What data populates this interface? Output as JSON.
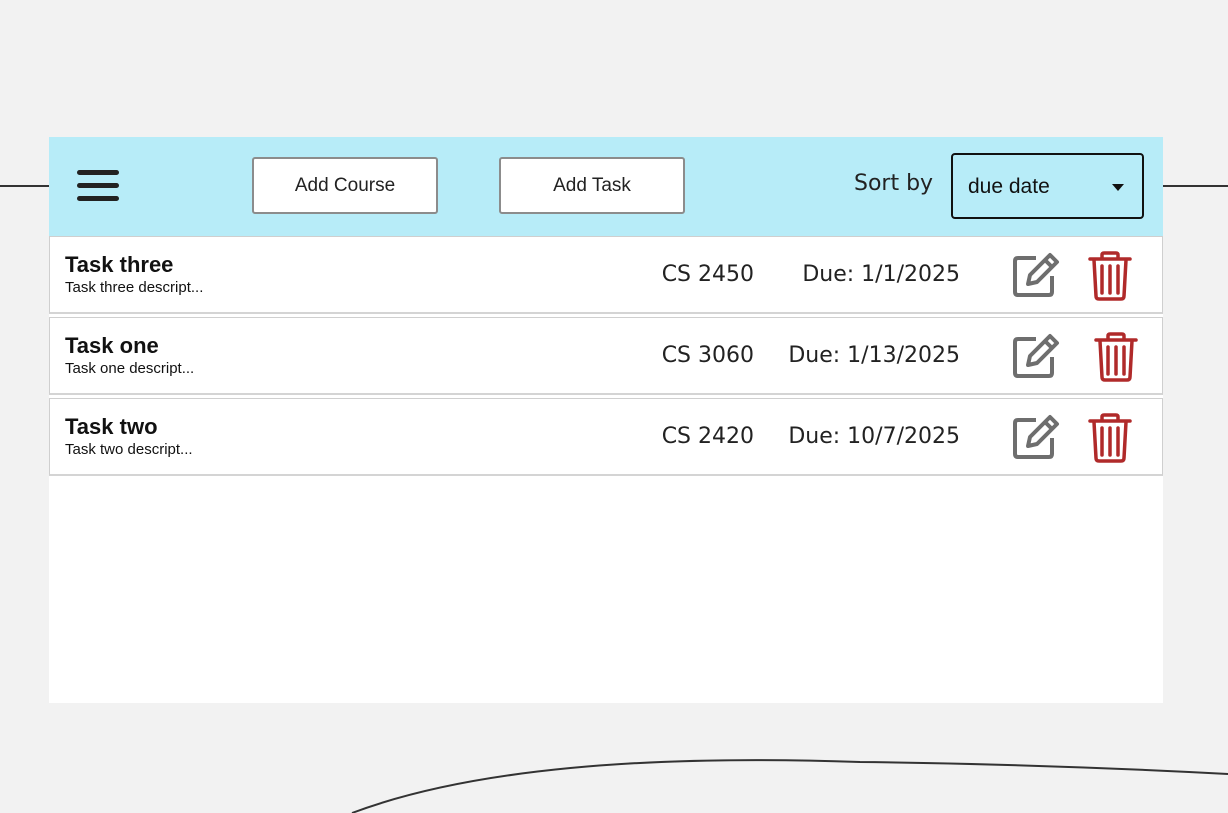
{
  "toolbar": {
    "menu_icon": "hamburger-menu-icon",
    "add_course_label": "Add Course",
    "add_task_label": "Add Task",
    "sort_label": "Sort by",
    "sort_value": "due date",
    "background_color": "#b7ecf8"
  },
  "tasks": [
    {
      "title": "Task three",
      "description": "Task three descript...",
      "course": "CS 2450",
      "due": "Due: 1/1/2025"
    },
    {
      "title": "Task one",
      "description": "Task one descript...",
      "course": "CS 3060",
      "due": "Due: 1/13/2025"
    },
    {
      "title": "Task two",
      "description": "Task two descript...",
      "course": "CS 2420",
      "due": "Due: 10/7/2025"
    }
  ],
  "icons": {
    "edit": "edit-icon",
    "delete": "trash-icon",
    "delete_color": "#b02a2a",
    "edit_color": "#6e6e6e"
  }
}
